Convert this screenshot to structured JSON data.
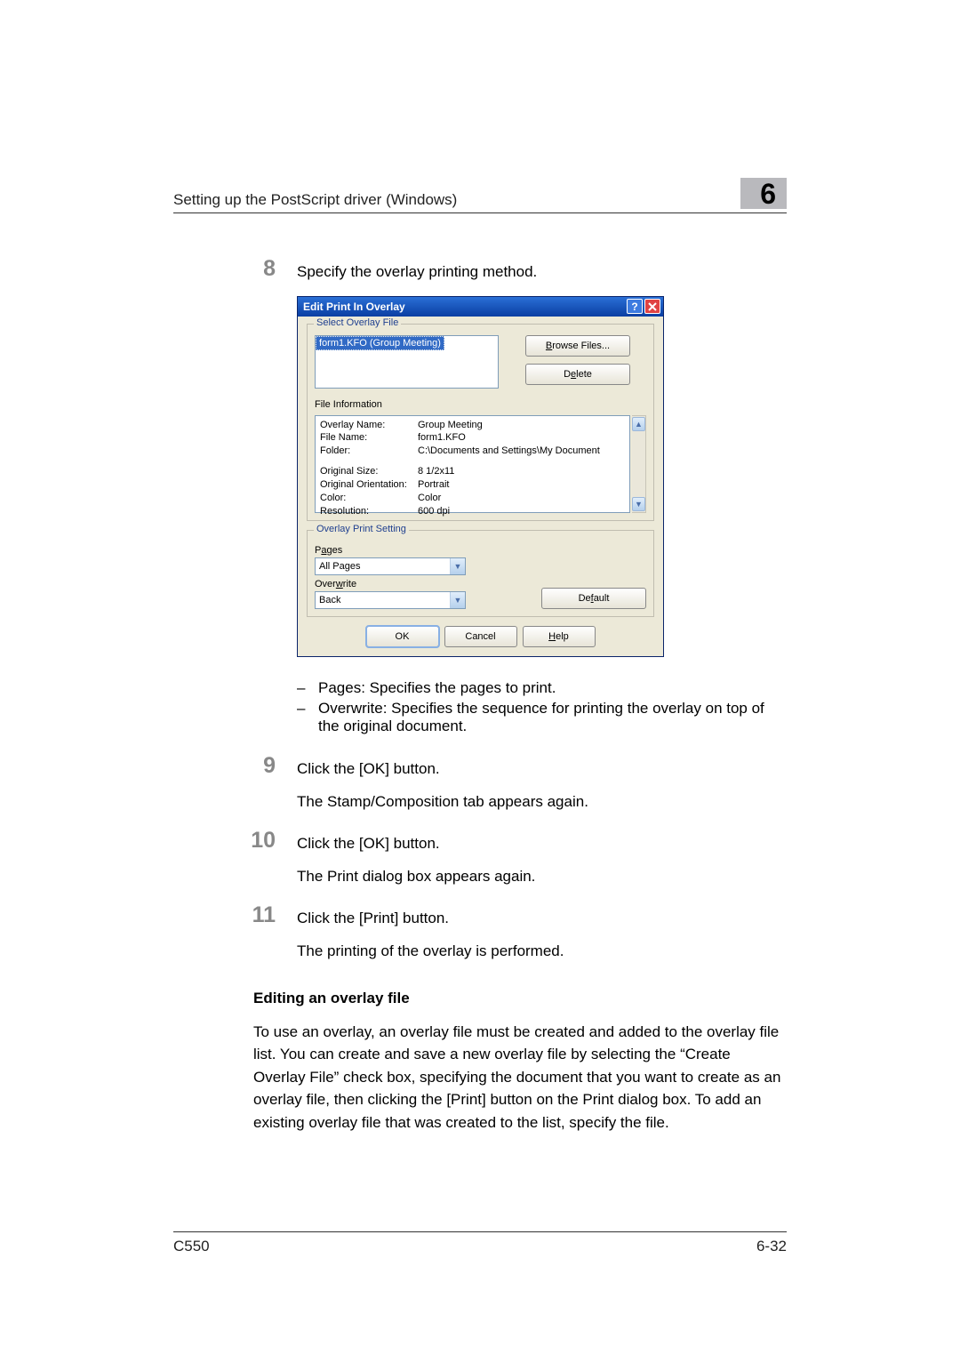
{
  "header": {
    "title": "Setting up the PostScript driver (Windows)",
    "chapter": "6"
  },
  "steps": {
    "s8": {
      "num": "8",
      "text": "Specify the overlay printing method.",
      "bullets": [
        "Pages: Specifies the pages to print.",
        "Overwrite: Specifies the sequence for printing the overlay on top of the original document."
      ]
    },
    "s9": {
      "num": "9",
      "text": "Click the [OK] button.",
      "sub": "The Stamp/Composition tab appears again."
    },
    "s10": {
      "num": "10",
      "text": "Click the [OK] button.",
      "sub": "The Print dialog box appears again."
    },
    "s11": {
      "num": "11",
      "text": "Click the [Print] button.",
      "sub": "The printing of the overlay is performed."
    }
  },
  "section": {
    "heading": "Editing an overlay file",
    "para": "To use an overlay, an overlay file must be created and added to the overlay file list. You can create and save a new overlay file by selecting the “Create Overlay File” check box, specifying the document that you want to create as an overlay file, then clicking the [Print] button on the Print dialog box. To add an existing overlay file that was created to the list, specify the file."
  },
  "footer": {
    "left": "C550",
    "right": "6-32"
  },
  "dialog": {
    "title": "Edit Print In Overlay",
    "select_group": "Select Overlay File",
    "list_selected": "form1.KFO (Group Meeting)",
    "browse": "Browse Files...",
    "delete": "Delete",
    "file_info_label": "File Information",
    "info": {
      "overlay_name_k": "Overlay Name:",
      "overlay_name_v": "Group Meeting",
      "file_name_k": "File Name:",
      "file_name_v": "form1.KFO",
      "folder_k": "Folder:",
      "folder_v": "C:\\Documents and Settings\\My Document",
      "size_k": "Original Size:",
      "size_v": "8 1/2x11",
      "orient_k": "Original Orientation:",
      "orient_v": "Portrait",
      "color_k": "Color:",
      "color_v": "Color",
      "res_k": "Resolution:",
      "res_v": "600 dpi"
    },
    "ops_group": "Overlay Print Setting",
    "pages_label": "Pages",
    "pages_value": "All Pages",
    "overwrite_label": "Overwrite",
    "overwrite_value": "Back",
    "default": "Default",
    "ok": "OK",
    "cancel": "Cancel",
    "help": "Help"
  }
}
